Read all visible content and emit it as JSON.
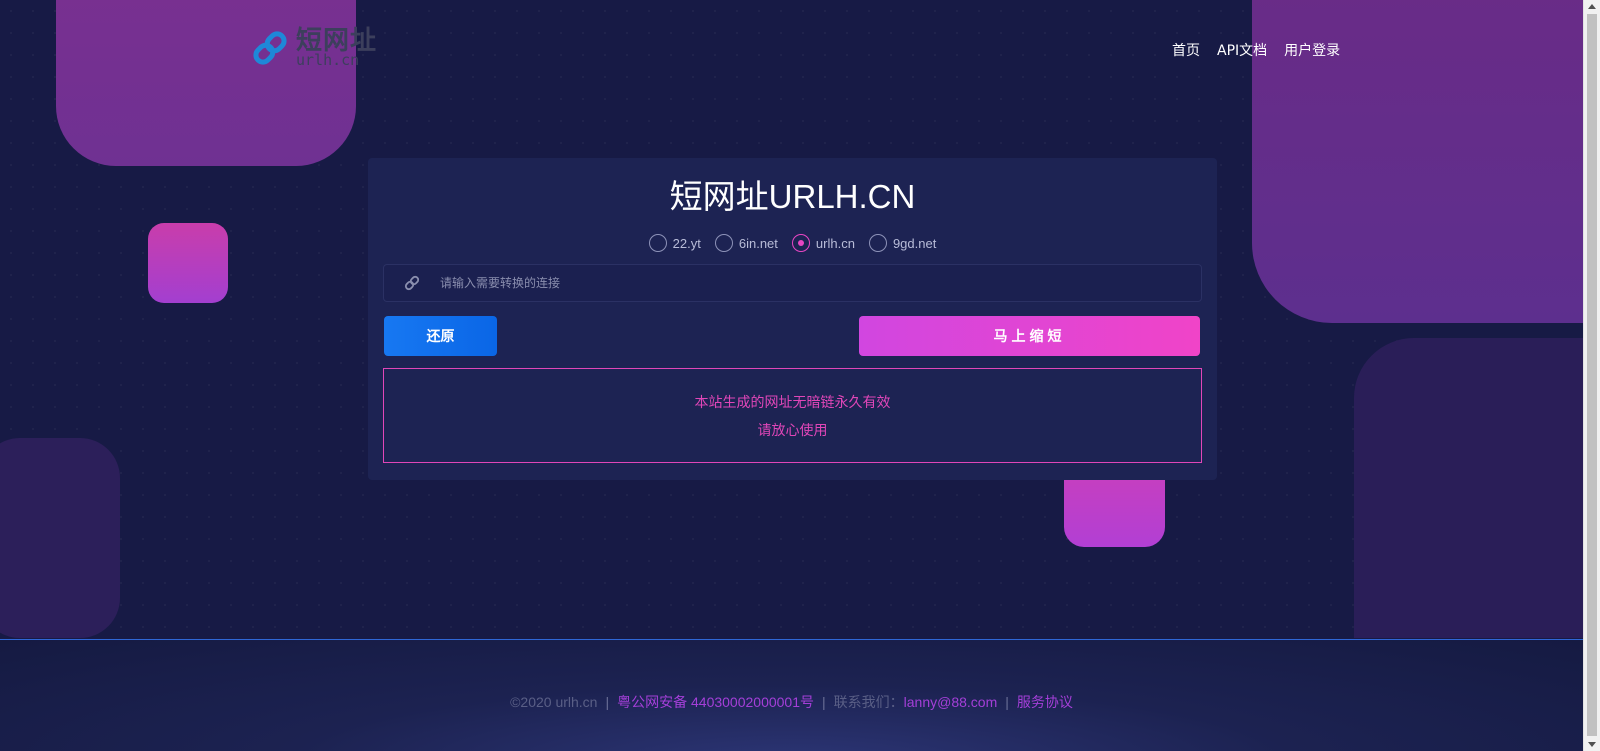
{
  "header": {
    "logo_cn": "短网址",
    "logo_en": "urlh.cn",
    "nav": [
      "首页",
      "API文档",
      "用户登录"
    ]
  },
  "card": {
    "title": "短网址URLH.CN",
    "domains": [
      {
        "label": "22.yt",
        "selected": false
      },
      {
        "label": "6in.net",
        "selected": false
      },
      {
        "label": "urlh.cn",
        "selected": true
      },
      {
        "label": "9gd.net",
        "selected": false
      }
    ],
    "input": {
      "placeholder": "请输入需要转换的连接",
      "value": ""
    },
    "restore_label": "还原",
    "shorten_label": "马上缩短",
    "notice_line1": "本站生成的网址无暗链永久有效",
    "notice_line2": "请放心使用"
  },
  "footer": {
    "copyright": "©2020 urlh.cn",
    "beian": "粤公网安备 44030002000001号",
    "contact_label": "联系我们：",
    "email": "lanny@88.com",
    "agreement": "服务协议"
  },
  "colors": {
    "background": "#171a45",
    "card": "#1d2353",
    "accent_pink": "#e846c4",
    "accent_blue": "#1778f2"
  }
}
